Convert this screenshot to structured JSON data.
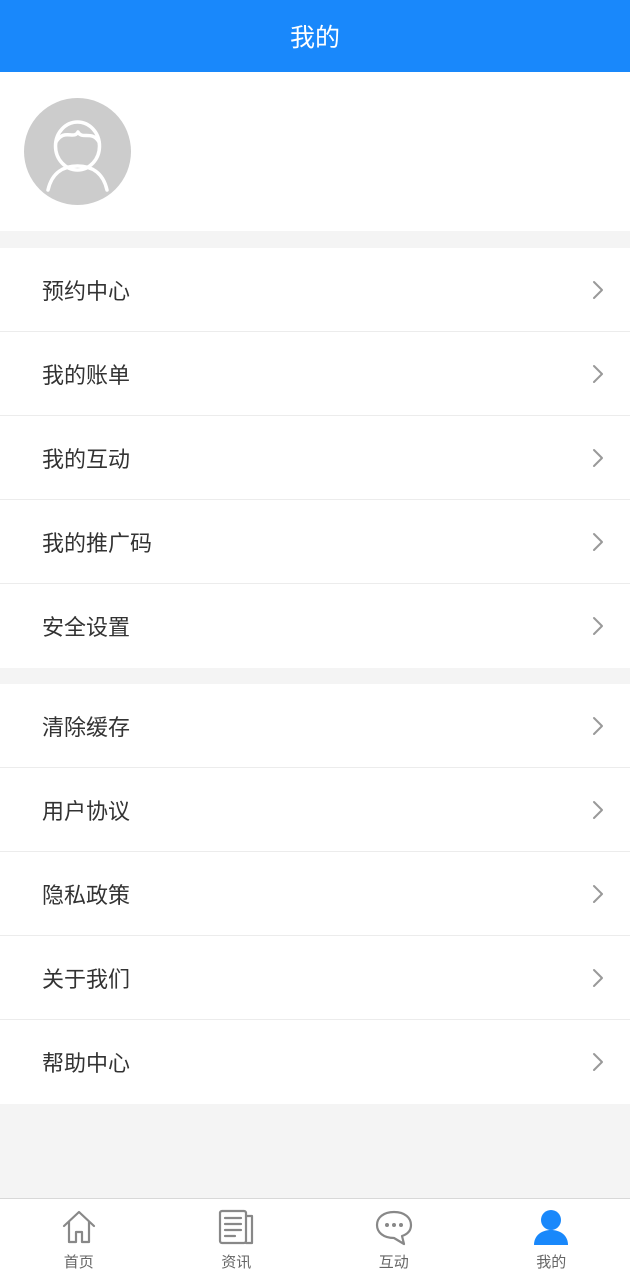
{
  "header": {
    "title": "我的"
  },
  "colors": {
    "primary": "#1988fb",
    "inactive_icon": "#888888",
    "avatar_bg": "#cccccc"
  },
  "menu_group_1": [
    {
      "label": "预约中心"
    },
    {
      "label": "我的账单"
    },
    {
      "label": "我的互动"
    },
    {
      "label": "我的推广码"
    },
    {
      "label": "安全设置"
    }
  ],
  "menu_group_2": [
    {
      "label": "清除缓存"
    },
    {
      "label": "用户协议"
    },
    {
      "label": "隐私政策"
    },
    {
      "label": "关于我们"
    },
    {
      "label": "帮助中心"
    }
  ],
  "tabbar": {
    "tabs": [
      {
        "label": "首页",
        "icon": "home-icon"
      },
      {
        "label": "资讯",
        "icon": "news-icon"
      },
      {
        "label": "互动",
        "icon": "chat-icon"
      },
      {
        "label": "我的",
        "icon": "user-icon",
        "active": true
      }
    ]
  }
}
